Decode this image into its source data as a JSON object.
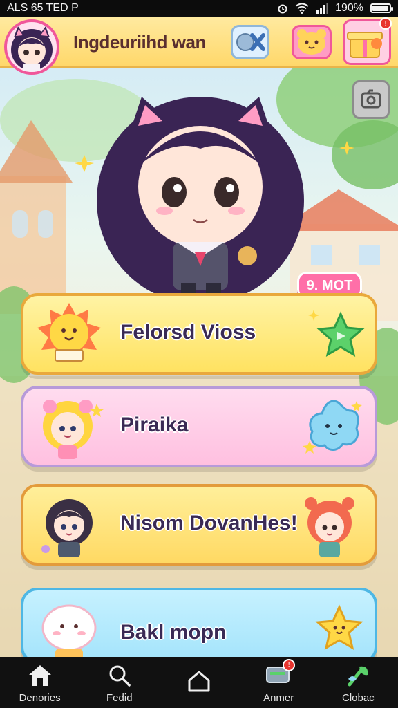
{
  "status_bar": {
    "carrier": "ALS 65 TED P",
    "battery": "190%",
    "battery_level": 0.9
  },
  "header": {
    "title": "Ingdeuriihd wan",
    "gift_badge": "!"
  },
  "hero": {
    "badge": "9. MOT"
  },
  "cards": [
    {
      "label": "Felorsd Vioss"
    },
    {
      "label": "Piraika"
    },
    {
      "label": "Nisom DovanHes!"
    },
    {
      "label": "Bakl mopn"
    }
  ],
  "nav": [
    {
      "label": "Denories"
    },
    {
      "label": "Fedid"
    },
    {
      "label": ""
    },
    {
      "label": "Anmer",
      "badge": "!"
    },
    {
      "label": "Clobac"
    }
  ],
  "colors": {
    "header": "#ffd86b",
    "accent_pink": "#ff6fa8",
    "card_yellow": "#ffe77a",
    "card_pink": "#ffc9e6",
    "card_blue": "#a9e7fb"
  }
}
